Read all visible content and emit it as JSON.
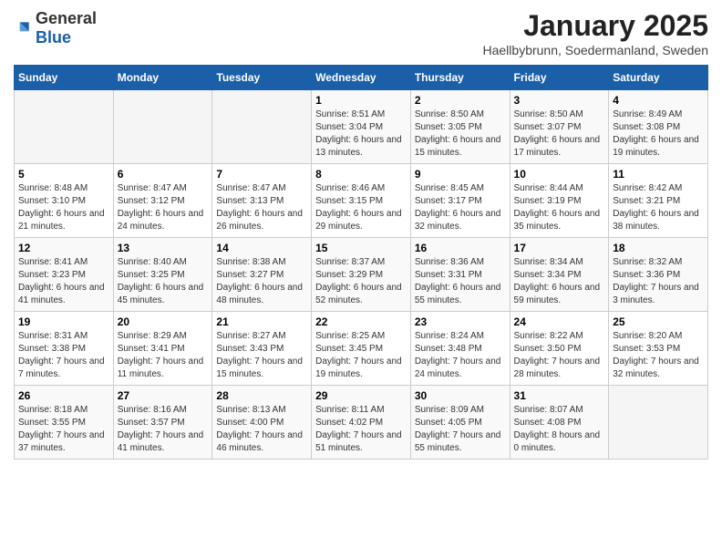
{
  "logo": {
    "general": "General",
    "blue": "Blue"
  },
  "title": "January 2025",
  "subtitle": "Haellbybrunn, Soedermanland, Sweden",
  "days_of_week": [
    "Sunday",
    "Monday",
    "Tuesday",
    "Wednesday",
    "Thursday",
    "Friday",
    "Saturday"
  ],
  "weeks": [
    [
      {
        "day": "",
        "info": ""
      },
      {
        "day": "",
        "info": ""
      },
      {
        "day": "",
        "info": ""
      },
      {
        "day": "1",
        "info": "Sunrise: 8:51 AM\nSunset: 3:04 PM\nDaylight: 6 hours and 13 minutes."
      },
      {
        "day": "2",
        "info": "Sunrise: 8:50 AM\nSunset: 3:05 PM\nDaylight: 6 hours and 15 minutes."
      },
      {
        "day": "3",
        "info": "Sunrise: 8:50 AM\nSunset: 3:07 PM\nDaylight: 6 hours and 17 minutes."
      },
      {
        "day": "4",
        "info": "Sunrise: 8:49 AM\nSunset: 3:08 PM\nDaylight: 6 hours and 19 minutes."
      }
    ],
    [
      {
        "day": "5",
        "info": "Sunrise: 8:48 AM\nSunset: 3:10 PM\nDaylight: 6 hours and 21 minutes."
      },
      {
        "day": "6",
        "info": "Sunrise: 8:47 AM\nSunset: 3:12 PM\nDaylight: 6 hours and 24 minutes."
      },
      {
        "day": "7",
        "info": "Sunrise: 8:47 AM\nSunset: 3:13 PM\nDaylight: 6 hours and 26 minutes."
      },
      {
        "day": "8",
        "info": "Sunrise: 8:46 AM\nSunset: 3:15 PM\nDaylight: 6 hours and 29 minutes."
      },
      {
        "day": "9",
        "info": "Sunrise: 8:45 AM\nSunset: 3:17 PM\nDaylight: 6 hours and 32 minutes."
      },
      {
        "day": "10",
        "info": "Sunrise: 8:44 AM\nSunset: 3:19 PM\nDaylight: 6 hours and 35 minutes."
      },
      {
        "day": "11",
        "info": "Sunrise: 8:42 AM\nSunset: 3:21 PM\nDaylight: 6 hours and 38 minutes."
      }
    ],
    [
      {
        "day": "12",
        "info": "Sunrise: 8:41 AM\nSunset: 3:23 PM\nDaylight: 6 hours and 41 minutes."
      },
      {
        "day": "13",
        "info": "Sunrise: 8:40 AM\nSunset: 3:25 PM\nDaylight: 6 hours and 45 minutes."
      },
      {
        "day": "14",
        "info": "Sunrise: 8:38 AM\nSunset: 3:27 PM\nDaylight: 6 hours and 48 minutes."
      },
      {
        "day": "15",
        "info": "Sunrise: 8:37 AM\nSunset: 3:29 PM\nDaylight: 6 hours and 52 minutes."
      },
      {
        "day": "16",
        "info": "Sunrise: 8:36 AM\nSunset: 3:31 PM\nDaylight: 6 hours and 55 minutes."
      },
      {
        "day": "17",
        "info": "Sunrise: 8:34 AM\nSunset: 3:34 PM\nDaylight: 6 hours and 59 minutes."
      },
      {
        "day": "18",
        "info": "Sunrise: 8:32 AM\nSunset: 3:36 PM\nDaylight: 7 hours and 3 minutes."
      }
    ],
    [
      {
        "day": "19",
        "info": "Sunrise: 8:31 AM\nSunset: 3:38 PM\nDaylight: 7 hours and 7 minutes."
      },
      {
        "day": "20",
        "info": "Sunrise: 8:29 AM\nSunset: 3:41 PM\nDaylight: 7 hours and 11 minutes."
      },
      {
        "day": "21",
        "info": "Sunrise: 8:27 AM\nSunset: 3:43 PM\nDaylight: 7 hours and 15 minutes."
      },
      {
        "day": "22",
        "info": "Sunrise: 8:25 AM\nSunset: 3:45 PM\nDaylight: 7 hours and 19 minutes."
      },
      {
        "day": "23",
        "info": "Sunrise: 8:24 AM\nSunset: 3:48 PM\nDaylight: 7 hours and 24 minutes."
      },
      {
        "day": "24",
        "info": "Sunrise: 8:22 AM\nSunset: 3:50 PM\nDaylight: 7 hours and 28 minutes."
      },
      {
        "day": "25",
        "info": "Sunrise: 8:20 AM\nSunset: 3:53 PM\nDaylight: 7 hours and 32 minutes."
      }
    ],
    [
      {
        "day": "26",
        "info": "Sunrise: 8:18 AM\nSunset: 3:55 PM\nDaylight: 7 hours and 37 minutes."
      },
      {
        "day": "27",
        "info": "Sunrise: 8:16 AM\nSunset: 3:57 PM\nDaylight: 7 hours and 41 minutes."
      },
      {
        "day": "28",
        "info": "Sunrise: 8:13 AM\nSunset: 4:00 PM\nDaylight: 7 hours and 46 minutes."
      },
      {
        "day": "29",
        "info": "Sunrise: 8:11 AM\nSunset: 4:02 PM\nDaylight: 7 hours and 51 minutes."
      },
      {
        "day": "30",
        "info": "Sunrise: 8:09 AM\nSunset: 4:05 PM\nDaylight: 7 hours and 55 minutes."
      },
      {
        "day": "31",
        "info": "Sunrise: 8:07 AM\nSunset: 4:08 PM\nDaylight: 8 hours and 0 minutes."
      },
      {
        "day": "",
        "info": ""
      }
    ]
  ]
}
